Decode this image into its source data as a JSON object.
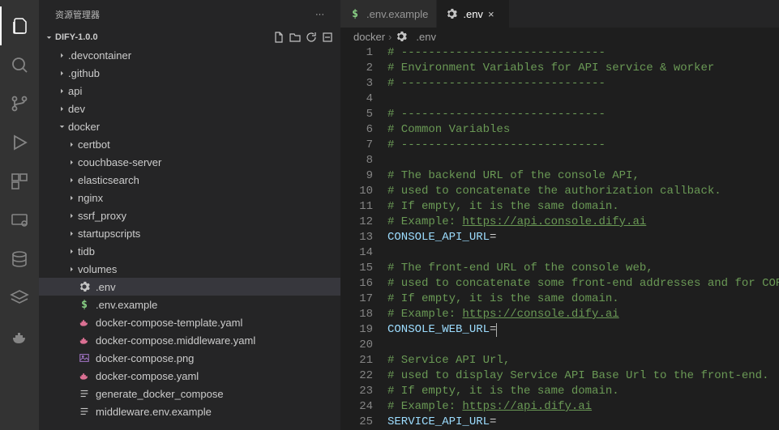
{
  "sidebar": {
    "title": "资源管理器",
    "project": "DIFY-1.0.0",
    "tree": [
      {
        "type": "folder",
        "label": ".devcontainer",
        "depth": 1,
        "expanded": false
      },
      {
        "type": "folder",
        "label": ".github",
        "depth": 1,
        "expanded": false
      },
      {
        "type": "folder",
        "label": "api",
        "depth": 1,
        "expanded": false
      },
      {
        "type": "folder",
        "label": "dev",
        "depth": 1,
        "expanded": false
      },
      {
        "type": "folder",
        "label": "docker",
        "depth": 1,
        "expanded": true
      },
      {
        "type": "folder",
        "label": "certbot",
        "depth": 2,
        "expanded": false
      },
      {
        "type": "folder",
        "label": "couchbase-server",
        "depth": 2,
        "expanded": false
      },
      {
        "type": "folder",
        "label": "elasticsearch",
        "depth": 2,
        "expanded": false
      },
      {
        "type": "folder",
        "label": "nginx",
        "depth": 2,
        "expanded": false
      },
      {
        "type": "folder",
        "label": "ssrf_proxy",
        "depth": 2,
        "expanded": false
      },
      {
        "type": "folder",
        "label": "startupscripts",
        "depth": 2,
        "expanded": false
      },
      {
        "type": "folder",
        "label": "tidb",
        "depth": 2,
        "expanded": false
      },
      {
        "type": "folder",
        "label": "volumes",
        "depth": 2,
        "expanded": false
      },
      {
        "type": "file",
        "label": ".env",
        "depth": 2,
        "icon": "gear",
        "selected": true
      },
      {
        "type": "file",
        "label": ".env.example",
        "depth": 2,
        "icon": "dollar"
      },
      {
        "type": "file",
        "label": "docker-compose-template.yaml",
        "depth": 2,
        "icon": "whale"
      },
      {
        "type": "file",
        "label": "docker-compose.middleware.yaml",
        "depth": 2,
        "icon": "whale"
      },
      {
        "type": "file",
        "label": "docker-compose.png",
        "depth": 2,
        "icon": "image"
      },
      {
        "type": "file",
        "label": "docker-compose.yaml",
        "depth": 2,
        "icon": "whale"
      },
      {
        "type": "file",
        "label": "generate_docker_compose",
        "depth": 2,
        "icon": "lines"
      },
      {
        "type": "file",
        "label": "middleware.env.example",
        "depth": 2,
        "icon": "lines"
      }
    ]
  },
  "tabs": [
    {
      "label": ".env.example",
      "icon": "dollar",
      "active": false
    },
    {
      "label": ".env",
      "icon": "gear",
      "active": true
    }
  ],
  "breadcrumbs": {
    "parts": [
      "docker",
      ".env"
    ],
    "last_icon": "gear"
  },
  "editor": {
    "lines": [
      {
        "n": 1,
        "tokens": [
          {
            "c": "c-comment",
            "t": "# ------------------------------"
          }
        ]
      },
      {
        "n": 2,
        "tokens": [
          {
            "c": "c-comment",
            "t": "# Environment Variables for API service & worker"
          }
        ]
      },
      {
        "n": 3,
        "tokens": [
          {
            "c": "c-comment",
            "t": "# ------------------------------"
          }
        ]
      },
      {
        "n": 4,
        "tokens": []
      },
      {
        "n": 5,
        "tokens": [
          {
            "c": "c-comment",
            "t": "# ------------------------------"
          }
        ]
      },
      {
        "n": 6,
        "tokens": [
          {
            "c": "c-comment",
            "t": "# Common Variables"
          }
        ]
      },
      {
        "n": 7,
        "tokens": [
          {
            "c": "c-comment",
            "t": "# ------------------------------"
          }
        ]
      },
      {
        "n": 8,
        "tokens": []
      },
      {
        "n": 9,
        "tokens": [
          {
            "c": "c-comment",
            "t": "# The backend URL of the console API,"
          }
        ]
      },
      {
        "n": 10,
        "tokens": [
          {
            "c": "c-comment",
            "t": "# used to concatenate the authorization callback."
          }
        ]
      },
      {
        "n": 11,
        "tokens": [
          {
            "c": "c-comment",
            "t": "# If empty, it is the same domain."
          }
        ]
      },
      {
        "n": 12,
        "tokens": [
          {
            "c": "c-comment",
            "t": "# Example: "
          },
          {
            "c": "c-link",
            "t": "https://api.console.dify.ai"
          }
        ]
      },
      {
        "n": 13,
        "tokens": [
          {
            "c": "c-var",
            "t": "CONSOLE_API_URL"
          },
          {
            "c": "c-op",
            "t": "="
          }
        ]
      },
      {
        "n": 14,
        "tokens": []
      },
      {
        "n": 15,
        "tokens": [
          {
            "c": "c-comment",
            "t": "# The front-end URL of the console web,"
          }
        ]
      },
      {
        "n": 16,
        "tokens": [
          {
            "c": "c-comment",
            "t": "# used to concatenate some front-end addresses and for CORS c"
          }
        ]
      },
      {
        "n": 17,
        "tokens": [
          {
            "c": "c-comment",
            "t": "# If empty, it is the same domain."
          }
        ]
      },
      {
        "n": 18,
        "tokens": [
          {
            "c": "c-comment",
            "t": "# Example: "
          },
          {
            "c": "c-link",
            "t": "https://console.dify.ai"
          }
        ]
      },
      {
        "n": 19,
        "tokens": [
          {
            "c": "c-var",
            "t": "CONSOLE_WEB_URL"
          },
          {
            "c": "c-op",
            "t": "="
          }
        ],
        "cursor_after": true
      },
      {
        "n": 20,
        "tokens": []
      },
      {
        "n": 21,
        "tokens": [
          {
            "c": "c-comment",
            "t": "# Service API Url,"
          }
        ]
      },
      {
        "n": 22,
        "tokens": [
          {
            "c": "c-comment",
            "t": "# used to display Service API Base Url to the front-end."
          }
        ]
      },
      {
        "n": 23,
        "tokens": [
          {
            "c": "c-comment",
            "t": "# If empty, it is the same domain."
          }
        ]
      },
      {
        "n": 24,
        "tokens": [
          {
            "c": "c-comment",
            "t": "# Example: "
          },
          {
            "c": "c-link",
            "t": "https://api.dify.ai"
          }
        ]
      },
      {
        "n": 25,
        "tokens": [
          {
            "c": "c-var",
            "t": "SERVICE_API_URL"
          },
          {
            "c": "c-op",
            "t": "="
          }
        ]
      }
    ]
  }
}
